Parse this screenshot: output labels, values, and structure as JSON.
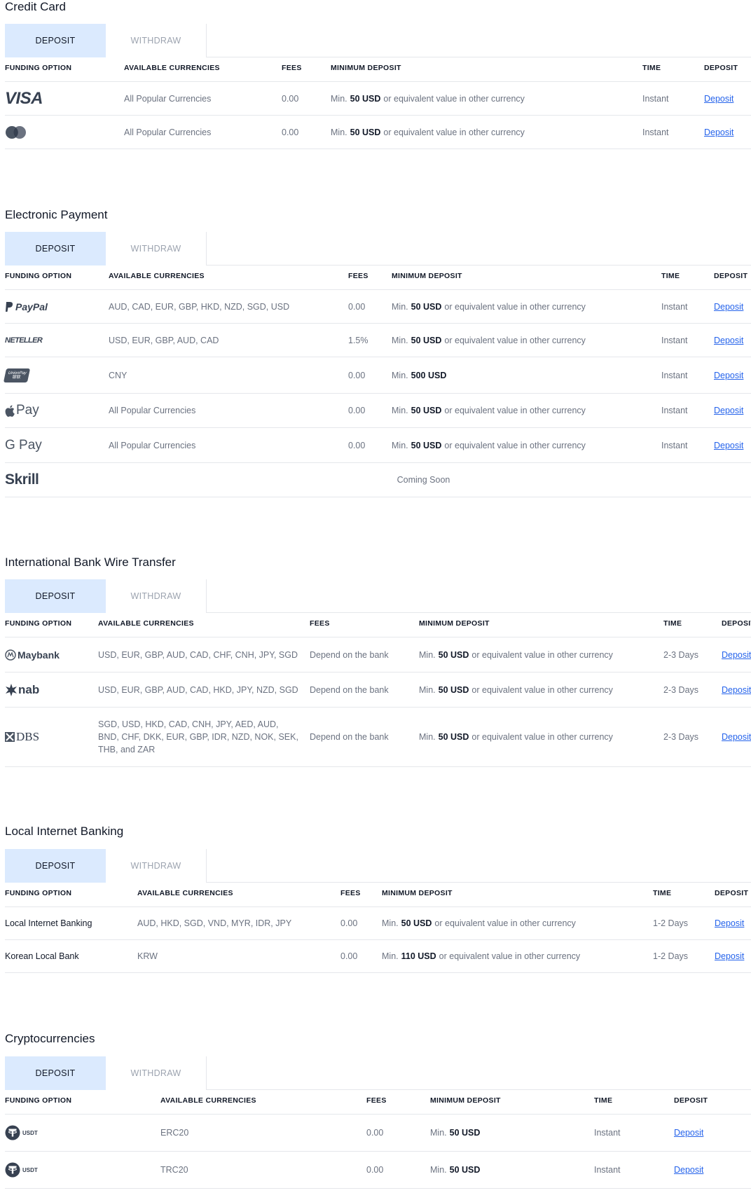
{
  "tabs": {
    "deposit": "DEPOSIT",
    "withdraw": "WITHDRAW"
  },
  "headers": {
    "funding": "FUNDING OPTION",
    "currencies": "AVAILABLE CURRENCIES",
    "fees": "FEES",
    "min": "MINIMUM DEPOSIT",
    "time": "TIME",
    "deposit": "DEPOSIT"
  },
  "common": {
    "min_prefix": "Min.",
    "equiv": "or equivalent value in other currency",
    "deposit_link": "Deposit"
  },
  "credit_card": {
    "title": "Credit Card",
    "rows": [
      {
        "logo": "VISA",
        "currencies": "All Popular Currencies",
        "fees": "0.00",
        "min_amount": "50 USD",
        "time": "Instant"
      },
      {
        "logo": "mastercard-icon",
        "currencies": "All Popular Currencies",
        "fees": "0.00",
        "min_amount": "50 USD",
        "time": "Instant"
      }
    ]
  },
  "electronic": {
    "title": "Electronic Payment",
    "rows": [
      {
        "logo": "PayPal",
        "currencies": "AUD, CAD, EUR, GBP, HKD, NZD, SGD, USD",
        "fees": "0.00",
        "min_amount": "50 USD",
        "time": "Instant"
      },
      {
        "logo": "NETELLER",
        "currencies": "USD, EUR, GBP, AUD, CAD",
        "fees": "1.5%",
        "min_amount": "50 USD",
        "time": "Instant"
      },
      {
        "logo": "UnionPay",
        "logo_sub": "银联",
        "currencies": "CNY",
        "fees": "0.00",
        "min_amount": "500 USD",
        "time": "Instant"
      },
      {
        "logo": "Pay",
        "currencies": "All Popular Currencies",
        "fees": "0.00",
        "min_amount": "50 USD",
        "time": "Instant"
      },
      {
        "logo": "G Pay",
        "currencies": "All Popular Currencies",
        "fees": "0.00",
        "min_amount": "50 USD",
        "time": "Instant"
      }
    ],
    "skrill": {
      "logo": "Skrill",
      "status": "Coming Soon"
    }
  },
  "wire": {
    "title": "International Bank Wire Transfer",
    "rows": [
      {
        "logo": "Maybank",
        "currencies": "USD, EUR, GBP, AUD, CAD, CHF, CNH, JPY, SGD",
        "fees": "Depend on the bank",
        "min_amount": "50 USD",
        "time": "2-3 Days"
      },
      {
        "logo": "nab",
        "currencies": "USD, EUR, GBP, AUD, CAD, HKD, JPY, NZD, SGD",
        "fees": "Depend on the bank",
        "min_amount": "50 USD",
        "time": "2-3 Days"
      },
      {
        "logo": "DBS",
        "currencies": "SGD, USD, HKD, CAD, CNH, JPY, AED, AUD, BND, CHF, DKK, EUR, GBP, IDR, NZD, NOK, SEK, THB, and ZAR",
        "fees": "Depend on the bank",
        "min_amount": "50 USD",
        "time": "2-3 Days"
      }
    ]
  },
  "local": {
    "title": "Local Internet Banking",
    "rows": [
      {
        "name": "Local Internet Banking",
        "currencies": "AUD, HKD, SGD, VND, MYR, IDR, JPY",
        "fees": "0.00",
        "min_amount": "50 USD",
        "time": "1-2 Days"
      },
      {
        "name": "Korean Local Bank",
        "currencies": "KRW",
        "fees": "0.00",
        "min_amount": "110 USD",
        "time": "1-2 Days"
      }
    ]
  },
  "crypto": {
    "title": "Cryptocurrencies",
    "rows": [
      {
        "logo": "USDT",
        "currencies": "ERC20",
        "fees": "0.00",
        "min_amount": "50 USD",
        "time": "Instant"
      },
      {
        "logo": "USDT",
        "currencies": "TRC20",
        "fees": "0.00",
        "min_amount": "50 USD",
        "time": "Instant"
      }
    ]
  },
  "colors": {
    "tab_active": "#dbeafe",
    "link": "#2563eb",
    "border": "#e5e7eb",
    "muted": "#6b7280"
  }
}
